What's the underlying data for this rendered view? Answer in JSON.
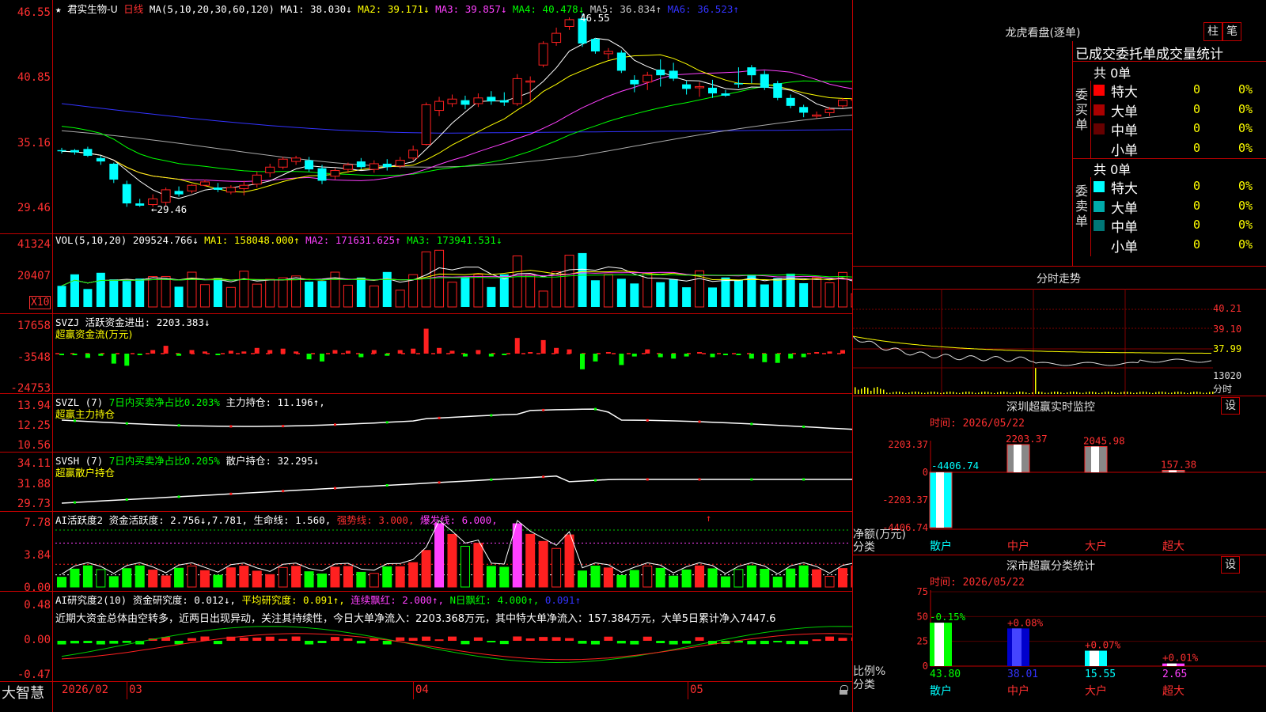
{
  "app": {
    "brand": "大智慧",
    "date_label": "2026/02",
    "month_labels": [
      "03",
      "04",
      "05"
    ]
  },
  "main_chart": {
    "star": "★",
    "stock_name": "君实生物-U",
    "period": "日线",
    "ma_label": "MA(5,10,20,30,60,120)",
    "ma_values": [
      {
        "label": "MA1: 38.030↓",
        "color": "#ffffff"
      },
      {
        "label": "MA2: 39.171↓",
        "color": "#ffff00"
      },
      {
        "label": "MA3: 39.857↓",
        "color": "#ff40ff"
      },
      {
        "label": "MA4: 40.478↓",
        "color": "#00ff00"
      },
      {
        "label": "MA5: 36.834↑",
        "color": "#cccccc"
      },
      {
        "label": "MA6: 36.523↑",
        "color": "#3333ff"
      }
    ],
    "y_ticks": [
      "46.55",
      "40.85",
      "35.16",
      "29.46"
    ],
    "high_label": "46.55",
    "low_label": "←29.46"
  },
  "vol_panel": {
    "label": "VOL(5,10,20)",
    "value": "209524.766↓",
    "ma1": "MA1: 158048.000↑",
    "ma2": "MA2: 171631.625↑",
    "ma3": "MA3: 173941.531↓",
    "y_ticks": [
      "41324",
      "20407"
    ],
    "unit": "X10"
  },
  "svzj_panel": {
    "label": "SVZJ",
    "title": "活跃资金进出: 2203.383↓",
    "subtitle": "超赢资金流(万元)",
    "y_ticks": [
      "17658",
      "-3548",
      "-24753"
    ]
  },
  "svzl_panel": {
    "label": "SVZL (7)",
    "ratio": "7日内买卖净占比0.203%",
    "holding": "主力持仓: 11.196↑,",
    "subtitle": "超赢主力持仓",
    "y_ticks": [
      "13.94",
      "12.25",
      "10.56"
    ]
  },
  "svsh_panel": {
    "label": "SVSH (7)",
    "ratio": "7日内买卖净占比0.205%",
    "holding": "散户持仓: 32.295↓",
    "subtitle": "超赢散户持仓",
    "y_ticks": [
      "34.11",
      "31.88",
      "29.73"
    ]
  },
  "ai_active_panel": {
    "label": "AI活跃度2",
    "active": "资金活跃度: 2.756↓,7.781,",
    "life": "生命线: 1.560,",
    "strong": "强势线: 3.000,",
    "burst": "爆发线: 6.000,",
    "y_ticks": [
      "7.78",
      "3.84",
      "0.00"
    ]
  },
  "ai_research_panel": {
    "label": "AI研究度2(10)",
    "research": "资金研究度: 0.012↓,",
    "avg": "平均研究度: 0.091↑,",
    "red1": "连续飘红: 2.000↑,",
    "red2": "N日飘红: 4.000↑,",
    "last": "0.091↑",
    "comment": "近期大资金总体由空转多，近两日出现异动，关注其持续性，今日大单净流入：2203.368万元，其中特大单净流入：157.384万元，大单5日累计净入7447.6",
    "y_ticks": [
      "0.48",
      "0.00",
      "-0.47"
    ]
  },
  "longhu": {
    "title": "龙虎看盘(逐单)",
    "btn_zhu": "柱",
    "btn_bi": "笔",
    "tabs": "已成交委托单成交量统计",
    "buy_side": "委买单",
    "sell_side": "委卖单",
    "buy_total": "共 0单",
    "sell_total": "共 0单",
    "buy_rows": [
      {
        "label": "特大",
        "color": "#ff0000",
        "count": "0",
        "pct": "0%"
      },
      {
        "label": "大单",
        "color": "#aa0000",
        "count": "0",
        "pct": "0%"
      },
      {
        "label": "中单",
        "color": "#660000",
        "count": "0",
        "pct": "0%"
      },
      {
        "label": "小单",
        "color": "",
        "count": "0",
        "pct": "0%"
      }
    ],
    "sell_rows": [
      {
        "label": "特大",
        "color": "#00ffff",
        "count": "0",
        "pct": "0%"
      },
      {
        "label": "大单",
        "color": "#00aaaa",
        "count": "0",
        "pct": "0%"
      },
      {
        "label": "中单",
        "color": "#007777",
        "count": "0",
        "pct": "0%"
      },
      {
        "label": "小单",
        "color": "",
        "count": "0",
        "pct": "0%"
      }
    ]
  },
  "intraday": {
    "title": "分时走势",
    "y_ticks": [
      "40.21",
      "39.10",
      "37.99",
      "13020",
      "分时"
    ]
  },
  "sz_monitor": {
    "title": "深圳超赢实时监控",
    "settings": "设",
    "time": "时间: 2026/05/22",
    "y_ticks": [
      "2203.37",
      "0",
      "-2203.37",
      "-4406.74"
    ],
    "ylabel": "净额(万元)",
    "xlabel": "分类",
    "categories": [
      "散户",
      "中户",
      "大户",
      "超大"
    ],
    "values": [
      -4406.74,
      2203.37,
      2045.98,
      157.38
    ],
    "value_labels": [
      "-4406.74",
      "2203.37",
      "2045.98",
      "157.38"
    ]
  },
  "sz_class": {
    "title": "深市超赢分类统计",
    "settings": "设",
    "time": "时间: 2026/05/22",
    "y_ticks": [
      "75",
      "50",
      "25",
      "0"
    ],
    "ylabel": "比例%",
    "xlabel": "分类",
    "categories": [
      "散户",
      "中户",
      "大户",
      "超大"
    ],
    "values": [
      43.8,
      38.01,
      15.55,
      2.65
    ],
    "value_labels": [
      "43.80",
      "38.01",
      "15.55",
      "2.65"
    ],
    "change_labels": [
      "-0.15%",
      "+0.08%",
      "+0.07%",
      "+0.01%"
    ]
  },
  "chart_data": {
    "type": "candlestick",
    "candles": [
      [
        34.5,
        34.4,
        34.7,
        34.2
      ],
      [
        34.5,
        34.3,
        34.6,
        34.1
      ],
      [
        34.6,
        34.0,
        34.8,
        33.9
      ],
      [
        33.8,
        33.5,
        34.0,
        33.2
      ],
      [
        33.3,
        31.9,
        33.4,
        31.6
      ],
      [
        31.5,
        29.8,
        31.8,
        29.5
      ],
      [
        29.8,
        29.6,
        30.2,
        29.5
      ],
      [
        29.7,
        30.2,
        30.6,
        29.5
      ],
      [
        29.9,
        31.0,
        31.2,
        29.6
      ],
      [
        30.9,
        30.6,
        31.3,
        30.4
      ],
      [
        30.9,
        31.4,
        31.5,
        30.7
      ],
      [
        31.4,
        31.7,
        31.9,
        31.3
      ],
      [
        31.2,
        31.0,
        31.6,
        30.8
      ],
      [
        30.8,
        31.2,
        31.4,
        30.6
      ],
      [
        31.1,
        31.4,
        31.8,
        30.5
      ],
      [
        31.5,
        32.3,
        32.6,
        31.2
      ],
      [
        32.5,
        33.0,
        33.3,
        32.1
      ],
      [
        33.0,
        33.7,
        33.9,
        32.8
      ],
      [
        33.5,
        33.8,
        34.0,
        33.2
      ],
      [
        33.6,
        32.8,
        33.9,
        32.6
      ],
      [
        32.9,
        31.8,
        33.2,
        31.5
      ],
      [
        32.2,
        32.7,
        32.9,
        31.9
      ],
      [
        32.8,
        33.2,
        33.4,
        32.5
      ],
      [
        33.5,
        33.0,
        33.8,
        32.8
      ],
      [
        32.8,
        33.3,
        33.6,
        32.5
      ],
      [
        33.3,
        33.0,
        33.7,
        32.7
      ],
      [
        33.1,
        33.6,
        33.9,
        32.9
      ],
      [
        33.8,
        34.5,
        34.9,
        33.6
      ],
      [
        35.0,
        38.5,
        38.7,
        34.9
      ],
      [
        38.0,
        38.8,
        39.2,
        37.5
      ],
      [
        38.6,
        39.0,
        39.4,
        38.3
      ],
      [
        38.9,
        38.5,
        39.3,
        38.1
      ],
      [
        38.6,
        39.1,
        39.5,
        38.3
      ],
      [
        39.2,
        38.8,
        39.7,
        38.5
      ],
      [
        38.9,
        38.7,
        39.6,
        38.4
      ],
      [
        38.6,
        40.8,
        41.2,
        38.4
      ],
      [
        40.6,
        40.6,
        41.0,
        38.8
      ],
      [
        42.0,
        43.9,
        44.1,
        41.8
      ],
      [
        44.0,
        44.8,
        45.3,
        43.7
      ],
      [
        45.4,
        46.0,
        46.2,
        45.1
      ],
      [
        46.1,
        43.9,
        46.55,
        43.6
      ],
      [
        44.3,
        43.2,
        44.4,
        43.0
      ],
      [
        43.0,
        43.2,
        43.5,
        42.5
      ],
      [
        43.1,
        41.5,
        43.3,
        41.3
      ],
      [
        40.7,
        40.3,
        41.1,
        39.6
      ],
      [
        40.5,
        41.1,
        41.4,
        39.8
      ],
      [
        41.6,
        41.1,
        42.5,
        40.1
      ],
      [
        41.5,
        40.8,
        42.2,
        40.6
      ],
      [
        40.3,
        39.9,
        40.6,
        39.4
      ],
      [
        40.0,
        40.1,
        40.5,
        39.2
      ],
      [
        40.0,
        39.5,
        40.7,
        39.1
      ],
      [
        39.5,
        39.3,
        39.8,
        39.2
      ],
      [
        40.4,
        40.3,
        41.8,
        40.0
      ],
      [
        41.8,
        41.1,
        42.0,
        40.4
      ],
      [
        41.2,
        40.0,
        41.5,
        39.8
      ],
      [
        40.4,
        39.1,
        40.6,
        38.9
      ],
      [
        39.1,
        38.4,
        39.4,
        38.2
      ],
      [
        38.3,
        37.8,
        38.5,
        37.4
      ],
      [
        37.5,
        37.6,
        37.9,
        37.3
      ],
      [
        37.8,
        38.1,
        38.3,
        37.5
      ],
      [
        38.4,
        38.9,
        39.1,
        38.2
      ],
      [
        38.9,
        39.0,
        40.1,
        38.7
      ],
      [
        39.0,
        37.1,
        39.3,
        36.9
      ]
    ]
  }
}
